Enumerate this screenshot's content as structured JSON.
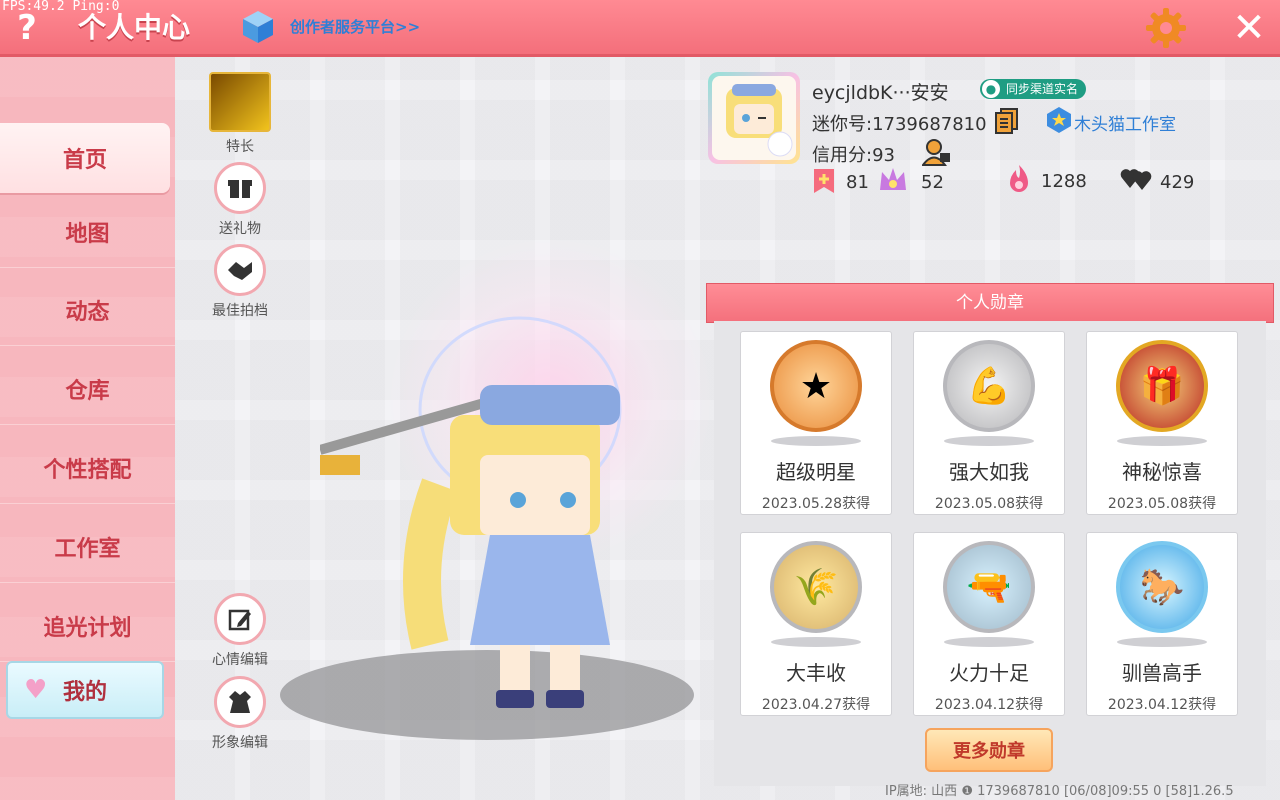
{
  "debug": {
    "fps_text": "FPS:49.2  Ping:0"
  },
  "header": {
    "help_glyph": "?",
    "title": "个人中心",
    "creator_link": "创作者服务平台>>",
    "close_glyph": "✕"
  },
  "sidebar": {
    "items": [
      {
        "label": "首页"
      },
      {
        "label": "地图"
      },
      {
        "label": "动态"
      },
      {
        "label": "仓库"
      },
      {
        "label": "个性搭配"
      },
      {
        "label": "工作室"
      },
      {
        "label": "追光计划"
      },
      {
        "label": "我的"
      }
    ]
  },
  "actions": {
    "specialty": "特长",
    "gift": "送礼物",
    "best_photo": "最佳拍档",
    "mood_edit": "心情编辑",
    "look_edit": "形象编辑"
  },
  "profile": {
    "name": "eycjldbK···安安",
    "verify": "同步渠道实名",
    "mini_id": "迷你号:1739687810",
    "credit": "信用分:93",
    "studio": "木头猫工作室",
    "stats": {
      "bookmark": "81",
      "crown": "52",
      "fire": "1288",
      "hearts": "429"
    }
  },
  "medals": {
    "title": "个人勋章",
    "items": [
      {
        "name": "超级明星",
        "date": "2023.05.28获得",
        "icon": "star-bear-icon"
      },
      {
        "name": "强大如我",
        "date": "2023.05.08获得",
        "icon": "muscle-icon"
      },
      {
        "name": "神秘惊喜",
        "date": "2023.05.08获得",
        "icon": "gift-icon"
      },
      {
        "name": "大丰收",
        "date": "2023.04.27获得",
        "icon": "harvest-icon"
      },
      {
        "name": "火力十足",
        "date": "2023.04.12获得",
        "icon": "weapon-box-icon"
      },
      {
        "name": "驯兽高手",
        "date": "2023.04.12获得",
        "icon": "rider-icon"
      }
    ],
    "more": "更多勋章"
  },
  "footer": {
    "text": "IP属地: 山西 ❶    1739687810    [06/08]09:55 0   [58]1.26.5"
  },
  "colors": {
    "header": "#f46f7b",
    "sidebar": "#f7b7be",
    "accent_text": "#c93b49",
    "link": "#2f7fd6",
    "verify": "#1f9d83"
  }
}
